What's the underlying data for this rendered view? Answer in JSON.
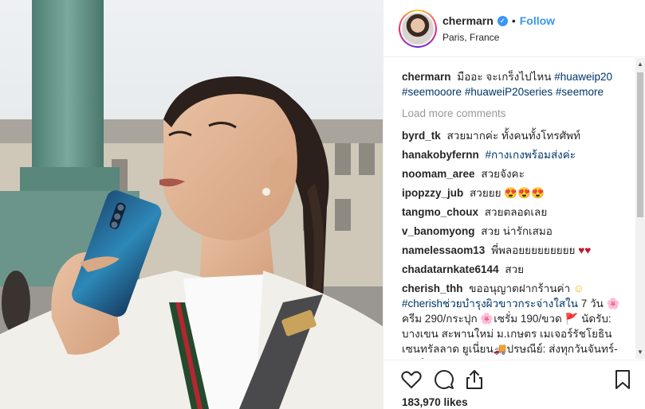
{
  "post": {
    "username": "chermarn",
    "location": "Paris, France",
    "follow_label": "Follow",
    "separator": "•",
    "verified_glyph": "✓"
  },
  "caption": {
    "user": "chermarn",
    "text": "มืออะ จะเกร็งไปไหน",
    "hashtags": [
      "#huaweip20",
      "#seemooore",
      "#huaweiP20series",
      "#seemore"
    ]
  },
  "load_more_label": "Load more comments",
  "comments": [
    {
      "user": "byrd_tk",
      "text": "สวยมากค่ะ ทั้งคนทั้งโทรศัพท์"
    },
    {
      "user": "hanakobyfernn",
      "text": "#กางเกงพร้อมส่งค่ะ"
    },
    {
      "user": "noomam_aree",
      "text": "สวยจังคะ"
    },
    {
      "user": "ipopzzy_jub",
      "text": "สวยยย",
      "emoji": "😍😍😍"
    },
    {
      "user": "tangmo_choux",
      "text": "สวยตลอดเลย"
    },
    {
      "user": "v_banomyong",
      "text": "สวย น่ารักเสมอ"
    },
    {
      "user": "namelessaom13",
      "text": "พี่พลอยยยยยยยยย",
      "emoji": "♥♥"
    },
    {
      "user": "chadatarnkate6144",
      "text": "สวย"
    }
  ],
  "long_comment": {
    "user": "cherish_thh",
    "text1": "ขออนุญาตฝากร้านค่า",
    "emoji1": "☺",
    "hashtag": "#cherishช่วยบำรุงผิวขาวกระจ่างใสใน",
    "text2": "7 วัน",
    "flower": "🌸",
    "text3": "ครีม 290/กระปุก",
    "text4": "เซรั่ม 190/ขวด",
    "flag": "🚩",
    "text5": "นัดรับ: บางเขน สะพานใหม่ ม.เกษตร เมเจอร์รัชโยธิน เซนทรัลลาด ยูเนี่ยน",
    "truck": "🚚",
    "text6": "ปรษณีย์: ส่งทุกวันจันทร์-เสาร์"
  },
  "icons": {
    "like": "heart-icon",
    "comment": "comment-icon",
    "share": "share-icon",
    "save": "bookmark-icon"
  },
  "likes_text": "183,970 likes",
  "colors": {
    "link_blue": "#3897f0",
    "hashtag_blue": "#003569",
    "muted": "#999999",
    "text": "#262626"
  }
}
